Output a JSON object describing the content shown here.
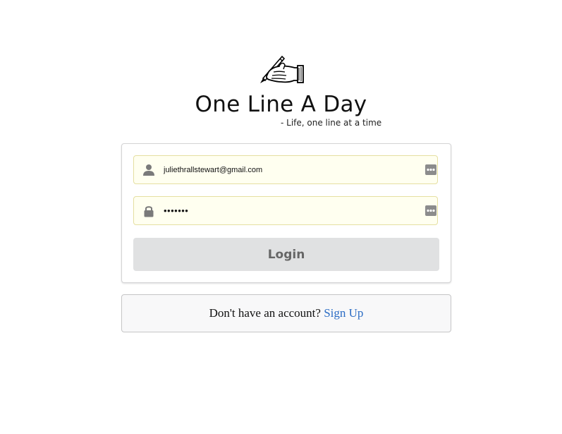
{
  "header": {
    "logo_icon": "hand-writing-with-pen-icon",
    "title": "One Line A Day",
    "tagline": "- Life, one line at a time"
  },
  "login_form": {
    "email": {
      "icon": "user-icon",
      "value": "juliethrallstewart@gmail.com",
      "autofill_icon": "keychain-icon"
    },
    "password": {
      "icon": "lock-icon",
      "value": "•••••••",
      "autofill_icon": "keychain-icon"
    },
    "login_label": "Login"
  },
  "signup": {
    "prompt": "Don't have an account?",
    "link_label": "Sign Up"
  },
  "colors": {
    "field_background": "#fffff0",
    "field_border": "#e5dfa1",
    "button_background": "#e0e1e2",
    "link": "#2b6cc4"
  }
}
